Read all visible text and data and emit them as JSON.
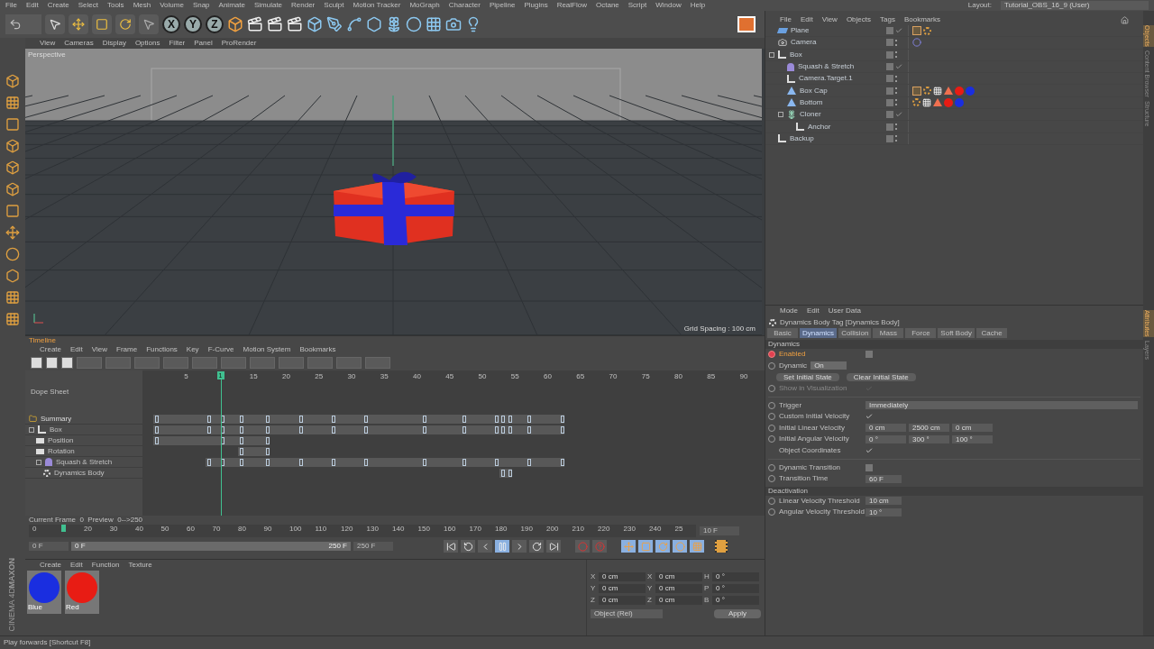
{
  "menu": [
    "File",
    "Edit",
    "Create",
    "Select",
    "Tools",
    "Mesh",
    "Volume",
    "Snap",
    "Animate",
    "Simulate",
    "Render",
    "Sculpt",
    "Motion Tracker",
    "MoGraph",
    "Character",
    "Pipeline",
    "Plugins",
    "RealFlow",
    "Octane",
    "Script",
    "Window",
    "Help"
  ],
  "layout": {
    "label": "Layout:",
    "value": "Tutorial_OBS_16_9 (User)"
  },
  "axis_buttons": [
    "X",
    "Y",
    "Z"
  ],
  "viewport": {
    "menu": [
      "View",
      "Cameras",
      "Display",
      "Options",
      "Filter",
      "Panel",
      "ProRender"
    ],
    "view_name": "Perspective",
    "grid_spacing": "Grid Spacing : 100 cm"
  },
  "timeline": {
    "title": "Timeline",
    "menu": [
      "Create",
      "Edit",
      "View",
      "Frame",
      "Functions",
      "Key",
      "F-Curve",
      "Motion System",
      "Bookmarks"
    ],
    "header": "Dope Sheet",
    "current": "1",
    "ruler": [
      "5",
      "15",
      "20",
      "25",
      "30",
      "35",
      "40",
      "45",
      "50",
      "55",
      "60",
      "65",
      "70",
      "75",
      "80",
      "85",
      "90"
    ],
    "tracks": [
      {
        "label": "Summary",
        "kind": "summary"
      },
      {
        "label": "Box",
        "kind": "null",
        "children": [
          {
            "label": "Position",
            "kind": "folder"
          },
          {
            "label": "Rotation",
            "kind": "folder"
          },
          {
            "label": "Squash & Stretch",
            "kind": "deformer",
            "children": [
              {
                "label": "Dynamics Body",
                "kind": "dynamics"
              }
            ]
          }
        ]
      }
    ]
  },
  "time_slider": {
    "info": "Current Frame  0  Preview  0-->250",
    "ticks": [
      "0",
      "20",
      "30",
      "40",
      "50",
      "60",
      "70",
      "80",
      "90",
      "100",
      "110",
      "120",
      "130",
      "140",
      "150",
      "160",
      "170",
      "180",
      "190",
      "200",
      "210",
      "220",
      "230",
      "240",
      "25"
    ],
    "step": "10 F",
    "start": "0 F",
    "range": {
      "level": 1
    },
    "range_start": "0 F",
    "range_end": "250 F",
    "end": "250 F"
  },
  "materials": {
    "menu": [
      "Create",
      "Edit",
      "Function",
      "Texture"
    ],
    "items": [
      {
        "name": "Blue",
        "color": "#1a2ee0"
      },
      {
        "name": "Red",
        "color": "#e81c14"
      }
    ]
  },
  "coordinates": {
    "rows": [
      [
        "X",
        "0 cm",
        "X",
        "0 cm",
        "H",
        "0 °"
      ],
      [
        "Y",
        "0 cm",
        "Y",
        "0 cm",
        "P",
        "0 °"
      ],
      [
        "Z",
        "0 cm",
        "Z",
        "0 cm",
        "B",
        "0 °"
      ]
    ],
    "mode": "Object (Rel)",
    "apply": "Apply"
  },
  "logo": [
    "MAXON",
    "CINEMA 4D"
  ],
  "status": "Play forwards [Shortcut F8]",
  "objects": {
    "menu": [
      "File",
      "Edit",
      "View",
      "Objects",
      "Tags",
      "Bookmarks"
    ],
    "items": [
      {
        "name": "Plane",
        "kind": "plane",
        "checked": true,
        "tags": [
          {
            "kind": "dynamics"
          },
          {
            "kind": "phong"
          }
        ]
      },
      {
        "name": "Camera",
        "kind": "camera",
        "checked": false,
        "tags": [
          {
            "kind": "target"
          }
        ]
      },
      {
        "name": "Box",
        "kind": "null",
        "checked": false,
        "children": [
          {
            "name": "Squash & Stretch",
            "kind": "deformer",
            "checked": true
          },
          {
            "name": "Camera.Target.1",
            "kind": "null",
            "checked": false
          },
          {
            "name": "Box Cap",
            "kind": "polygon",
            "checked": false,
            "tags": [
              {
                "kind": "dynamics"
              },
              {
                "kind": "phong"
              },
              {
                "kind": "checker"
              },
              {
                "kind": "cone"
              },
              {
                "kind": "red"
              },
              {
                "kind": "blue"
              }
            ]
          },
          {
            "name": "Bottom",
            "kind": "polygon",
            "checked": false,
            "tags": [
              {
                "kind": "phong"
              },
              {
                "kind": "checker"
              },
              {
                "kind": "cone"
              },
              {
                "kind": "red"
              },
              {
                "kind": "blue"
              }
            ]
          },
          {
            "name": "Cloner",
            "kind": "cloner",
            "checked": true,
            "children": [
              {
                "name": "Anchor",
                "kind": "null",
                "checked": false
              }
            ]
          }
        ]
      },
      {
        "name": "Backup",
        "kind": "null",
        "checked": false
      }
    ]
  },
  "attributes": {
    "menu": [
      "Mode",
      "Edit",
      "User Data"
    ],
    "title": "Dynamics Body Tag [Dynamics Body]",
    "tabs": [
      {
        "label": "Basic",
        "selected": false
      },
      {
        "label": "Dynamics",
        "selected": true
      },
      {
        "label": "Collision",
        "selected": false
      },
      {
        "label": "Mass",
        "selected": false
      },
      {
        "label": "Force",
        "selected": false
      },
      {
        "label": "Soft Body",
        "selected": false
      },
      {
        "label": "Cache",
        "selected": false
      }
    ],
    "sections": [
      {
        "title": "Dynamics",
        "rows": [
          {
            "kind": "checkbox",
            "label": "Enabled",
            "keyed": true,
            "checked": false,
            "disabled": false
          },
          {
            "kind": "dropdown",
            "label": "Dynamic",
            "keyed": false,
            "value": "On"
          },
          {
            "kind": "buttons",
            "buttons": [
              "Set Initial State",
              "Clear Initial State"
            ]
          },
          {
            "kind": "checkbox",
            "label": "Show in Visualization",
            "keyed": false,
            "checked": true,
            "disabled": true
          },
          {
            "kind": "divider"
          },
          {
            "kind": "wide-dropdown",
            "label": "Trigger",
            "keyed": false,
            "value": "Immediately"
          },
          {
            "kind": "checkbox",
            "label": "Custom Initial Velocity",
            "keyed": false,
            "checked": true,
            "disabled": false
          },
          {
            "kind": "vector",
            "label": "Initial Linear Velocity",
            "keyed": false,
            "values": [
              "0 cm",
              "2500 cm",
              "0 cm"
            ]
          },
          {
            "kind": "vector",
            "label": "Initial Angular Velocity",
            "keyed": false,
            "values": [
              "0 °",
              "300 °",
              "100 °"
            ]
          },
          {
            "kind": "checkbox",
            "label": "Object Coordinates",
            "checked": true,
            "disabled": false
          },
          {
            "kind": "divider"
          },
          {
            "kind": "checkbox",
            "label": "Dynamic Transition",
            "keyed": false,
            "checked": false,
            "disabled": false
          },
          {
            "kind": "field",
            "label": "Transition Time",
            "keyed": false,
            "value": "60 F"
          }
        ]
      },
      {
        "title": "Deactivation",
        "rows": [
          {
            "kind": "field",
            "label": "Linear Velocity Threshold",
            "keyed": false,
            "value": "10 cm"
          },
          {
            "kind": "field",
            "label": "Angular Velocity Threshold",
            "keyed": false,
            "value": "10 °"
          }
        ]
      }
    ]
  },
  "side_tabs": [
    {
      "label": "Objects",
      "selected": true
    },
    {
      "label": "Content Browser",
      "selected": false
    },
    {
      "label": "Structure",
      "selected": false
    },
    {
      "label": "Attributes",
      "selected": true
    },
    {
      "label": "Layers",
      "selected": false
    }
  ]
}
